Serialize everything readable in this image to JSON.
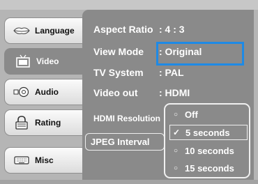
{
  "tabs": [
    {
      "label": "Language",
      "icon": "lips-icon"
    },
    {
      "label": "Video",
      "icon": "tv-icon"
    },
    {
      "label": "Audio",
      "icon": "speaker-icon"
    },
    {
      "label": "Rating",
      "icon": "lock-icon"
    },
    {
      "label": "Misc",
      "icon": "keyboard-icon"
    }
  ],
  "settings": {
    "aspect_ratio": {
      "label": "Aspect Ratio",
      "value": ": 4 : 3"
    },
    "view_mode": {
      "label": "View Mode",
      "value": ": Original"
    },
    "tv_system": {
      "label": "TV System",
      "value": ": PAL"
    },
    "video_out": {
      "label": "Video out",
      "value": ": HDMI"
    },
    "hdmi_resolution": {
      "label": "HDMI Resolution"
    },
    "jpeg_interval": {
      "label": "JPEG Interval"
    }
  },
  "jpeg_options": [
    {
      "label": "Off",
      "selected": false
    },
    {
      "label": "5 seconds",
      "selected": true
    },
    {
      "label": "10 seconds",
      "selected": false
    },
    {
      "label": "15 seconds",
      "selected": false
    }
  ],
  "colors": {
    "panel": "#8a8a8a",
    "highlight": "#1e8ae6"
  }
}
